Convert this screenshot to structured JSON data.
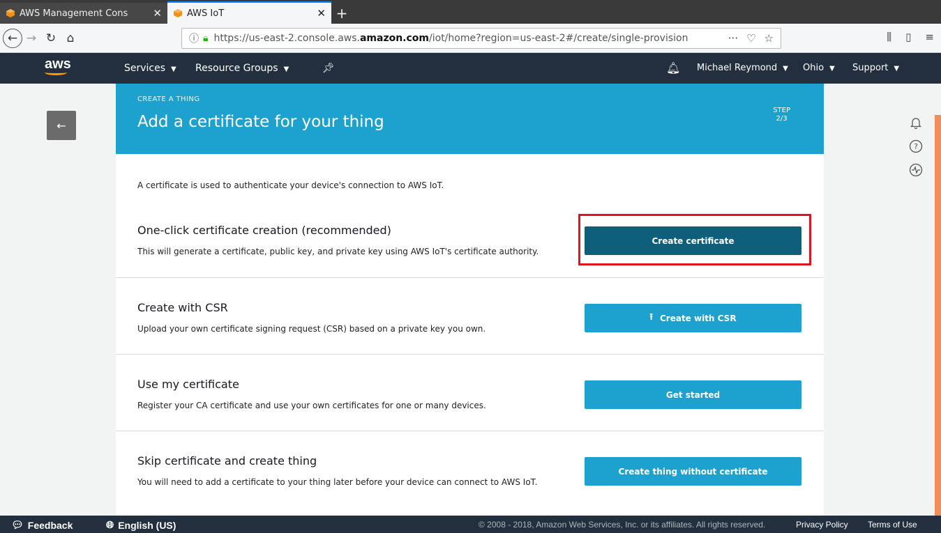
{
  "browser": {
    "tabs": [
      {
        "title": "AWS Management Cons",
        "active": false
      },
      {
        "title": "AWS IoT",
        "active": true
      }
    ],
    "url_prefix": "https://us-east-2.console.aws.",
    "url_domain": "amazon.com",
    "url_path": "/iot/home?region=us-east-2#/create/single-provision"
  },
  "aws_header": {
    "logo": "aws",
    "services": "Services",
    "resource_groups": "Resource Groups",
    "user": "Michael Reymond",
    "region": "Ohio",
    "support": "Support"
  },
  "banner": {
    "kicker": "CREATE A THING",
    "title": "Add a certificate for your thing",
    "step_label": "STEP",
    "step_value": "2/3"
  },
  "intro": "A certificate is used to authenticate your device's connection to AWS IoT.",
  "sections": [
    {
      "title": "One-click certificate creation (recommended)",
      "desc": "This will generate a certificate, public key, and private key using AWS IoT's certificate authority.",
      "button": "Create certificate"
    },
    {
      "title": "Create with CSR",
      "desc": "Upload your own certificate signing request (CSR) based on a private key you own.",
      "button": "Create with CSR"
    },
    {
      "title": "Use my certificate",
      "desc": "Register your CA certificate and use your own certificates for one or many devices.",
      "button": "Get started"
    },
    {
      "title": "Skip certificate and create thing",
      "desc": "You will need to add a certificate to your thing later before your device can connect to AWS IoT.",
      "button": "Create thing without certificate"
    }
  ],
  "footer": {
    "feedback": "Feedback",
    "language": "English (US)",
    "copyright": "© 2008 - 2018, Amazon Web Services, Inc. or its affiliates. All rights reserved.",
    "privacy": "Privacy Policy",
    "terms": "Terms of Use"
  },
  "colors": {
    "aws_nav": "#232f3e",
    "banner": "#1da2cf",
    "primary_button": "#0f5f7a",
    "highlight": "#e0141f"
  }
}
